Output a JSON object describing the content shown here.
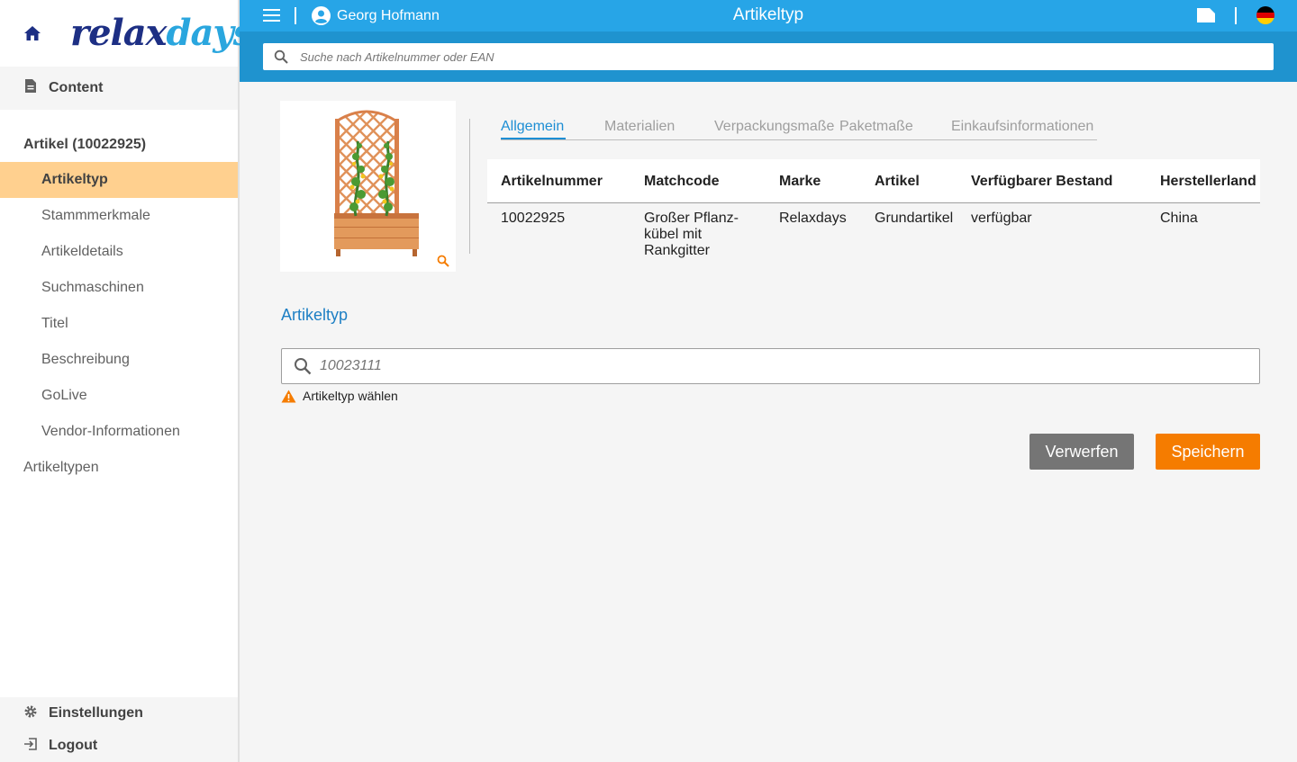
{
  "sidebar": {
    "brand_part1": "relax",
    "brand_part2": "days",
    "content_label": "Content",
    "article_heading": "Artikel (10022925)",
    "items": [
      {
        "label": "Artikeltyp"
      },
      {
        "label": "Stammmerkmale"
      },
      {
        "label": "Artikeldetails"
      },
      {
        "label": "Suchmaschinen"
      },
      {
        "label": "Titel"
      },
      {
        "label": "Beschreibung"
      },
      {
        "label": "GoLive"
      },
      {
        "label": "Vendor-Informationen"
      }
    ],
    "root_item": "Artikeltypen",
    "settings_label": "Einstellungen",
    "logout_label": "Logout"
  },
  "header": {
    "user_name": "Georg Hofmann",
    "title": "Artikeltyp",
    "search_placeholder": "Suche nach Artikelnummer oder EAN"
  },
  "tabs": [
    {
      "label": "Allgemein",
      "active": true
    },
    {
      "label": "Materialien"
    },
    {
      "label": "Verpackungsmaße"
    },
    {
      "label": "Paketmaße"
    },
    {
      "label": "Einkaufsinformationen"
    }
  ],
  "table": {
    "columns": [
      "Artikelnummer",
      "Matchcode",
      "Marke",
      "Artikel",
      "Verfügbarer Bestand",
      "Herstellerland"
    ],
    "row": {
      "artikelnummer": "10022925",
      "matchcode_lines": [
        "Großer Pflanz-",
        "kübel mit",
        "Rankgitter"
      ],
      "marke": "Relaxdays",
      "artikel": "Grundartikel",
      "bestand": "verfügbar",
      "herstellerland": "China"
    }
  },
  "section": {
    "title": "Artikeltyp",
    "search_placeholder": "10023111",
    "warning": "Artikeltyp wählen"
  },
  "buttons": {
    "discard": "Verwerfen",
    "save": "Speichern"
  },
  "colors": {
    "header_blue": "#27a5e7",
    "band_blue": "#1f93cf",
    "active_nav": "#ffd08f",
    "accent_orange": "#f57c00",
    "discard_grey": "#757575"
  }
}
